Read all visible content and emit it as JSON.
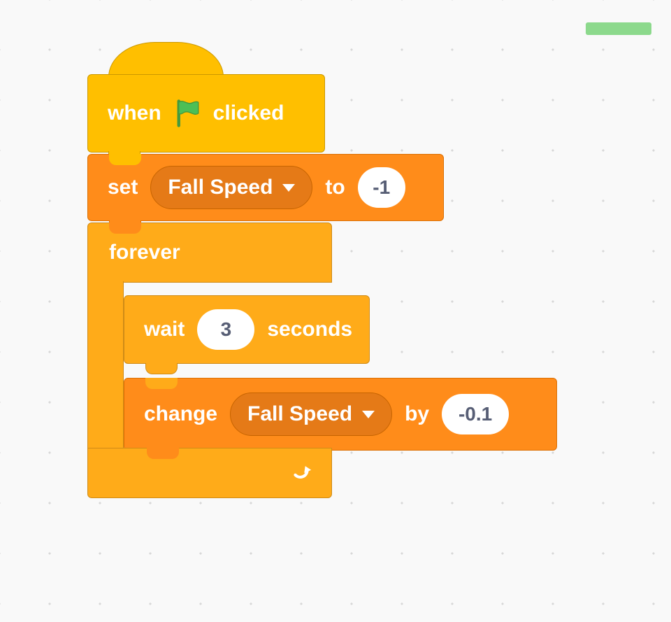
{
  "hat": {
    "when": "when",
    "clicked": "clicked"
  },
  "set": {
    "cmd": "set",
    "var": "Fall Speed",
    "to": "to",
    "val": "-1"
  },
  "forever": {
    "label": "forever"
  },
  "wait": {
    "cmd": "wait",
    "val": "3",
    "unit": "seconds"
  },
  "change": {
    "cmd": "change",
    "var": "Fall Speed",
    "by": "by",
    "val": "-0.1"
  }
}
